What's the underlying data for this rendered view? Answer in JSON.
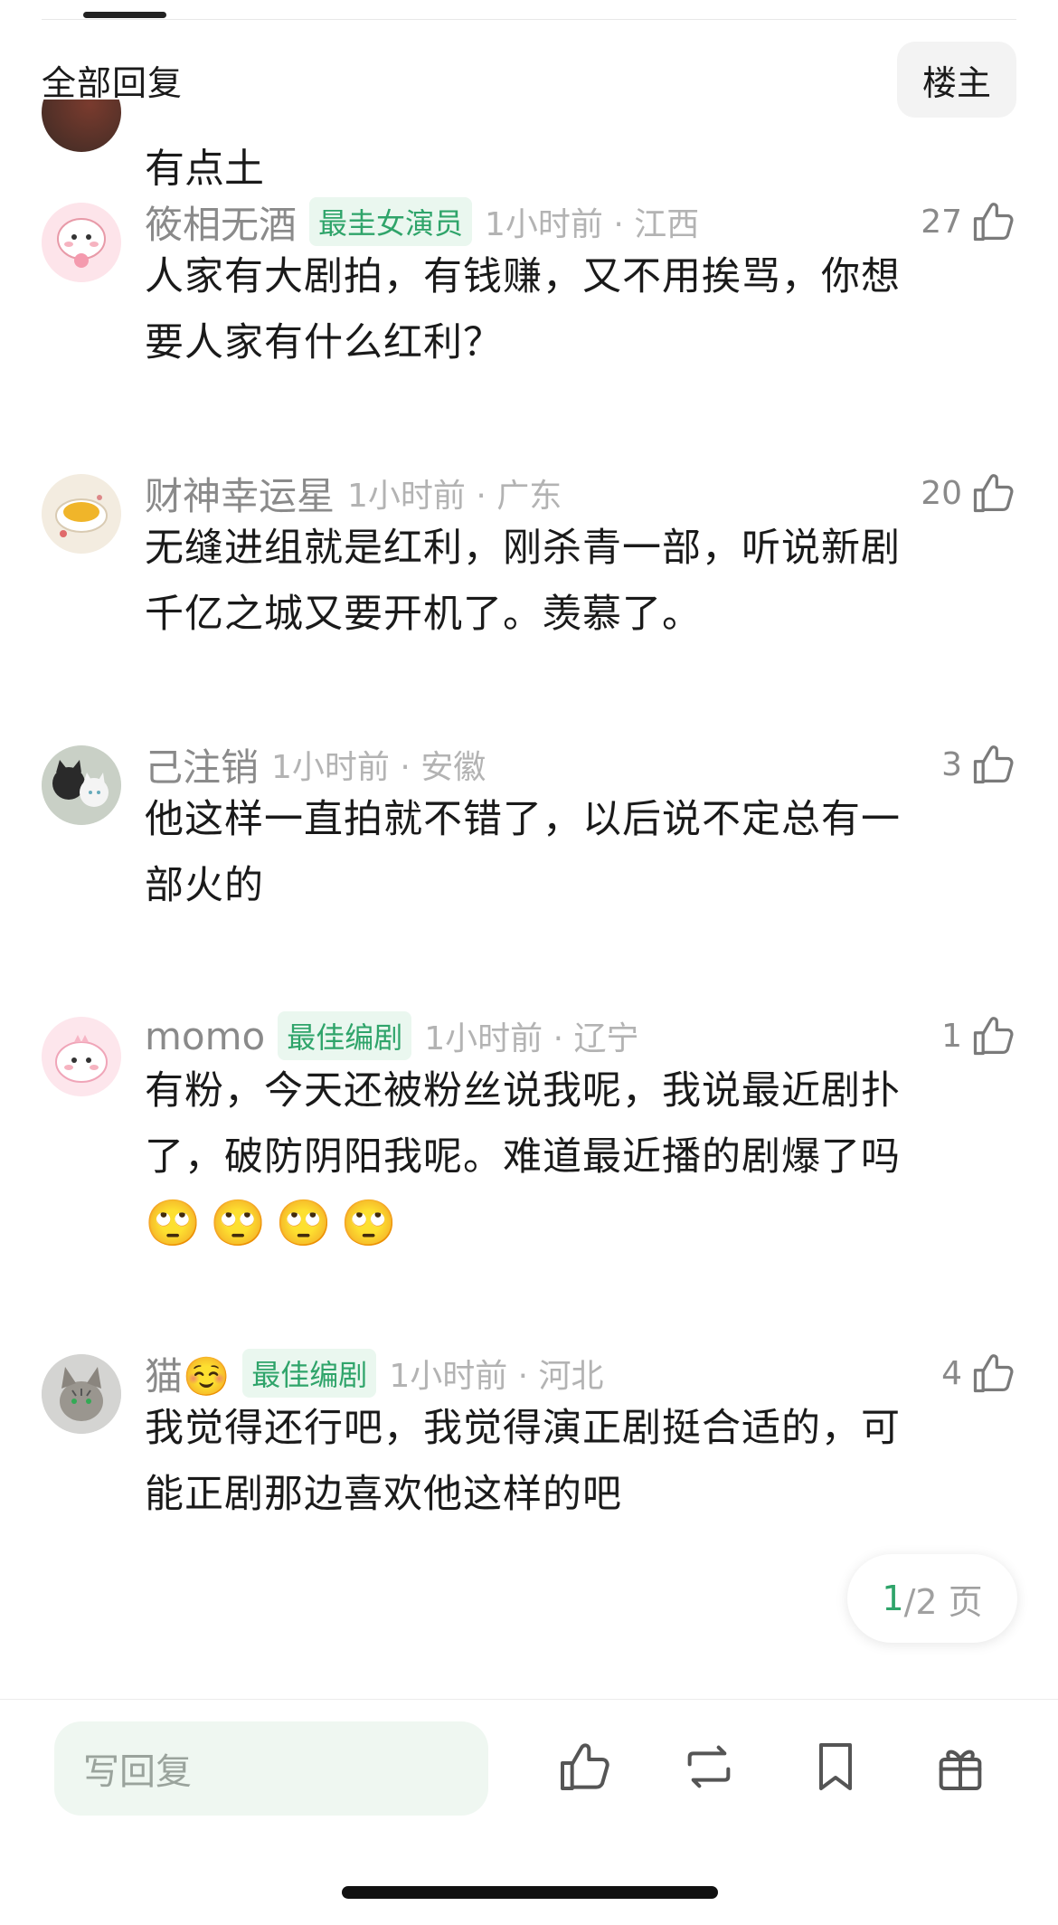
{
  "header": {
    "title": "全部回复",
    "owner_button": "楼主"
  },
  "partial_comment": {
    "text": "有点土"
  },
  "comments": [
    {
      "username": "筱相无酒",
      "badge": "最圭女演员",
      "time_location": "1小时前 · 江西",
      "likes": "27",
      "lines": [
        "人家有大剧拍，有钱赚，又不用挨骂，你想",
        "要人家有什么红利？"
      ]
    },
    {
      "username": "财神幸运星",
      "badge": "",
      "time_location": "1小时前 · 广东",
      "likes": "20",
      "lines": [
        "无缝进组就是红利，刚杀青一部，听说新剧",
        "千亿之城又要开机了。羡慕了。"
      ]
    },
    {
      "username": "己注销",
      "badge": "",
      "time_location": "1小时前 · 安徽",
      "likes": "3",
      "lines": [
        "他这样一直拍就不错了，以后说不定总有一",
        "部火的"
      ]
    },
    {
      "username": "momo",
      "badge": "最佳编剧",
      "time_location": "1小时前 · 辽宁",
      "likes": "1",
      "lines": [
        "有粉，今天还被粉丝说我呢，我说最近剧扑",
        "了，破防阴阳我呢。难道最近播的剧爆了吗",
        "🙄🙄🙄🙄"
      ]
    },
    {
      "username": "猫☺️",
      "badge": "最佳编剧",
      "time_location": "1小时前 · 河北",
      "likes": "4",
      "lines": [
        "我觉得还行吧，我觉得演正剧挺合适的，可",
        "能正剧那边喜欢他这样的吧"
      ]
    }
  ],
  "pagination": {
    "current": "1",
    "rest": "/2 页"
  },
  "bottom_bar": {
    "reply_placeholder": "写回复"
  },
  "colors": {
    "accent_green": "#2fa46a",
    "badge_bg": "#eaf7ef",
    "meta_gray": "#8a8a8a"
  }
}
